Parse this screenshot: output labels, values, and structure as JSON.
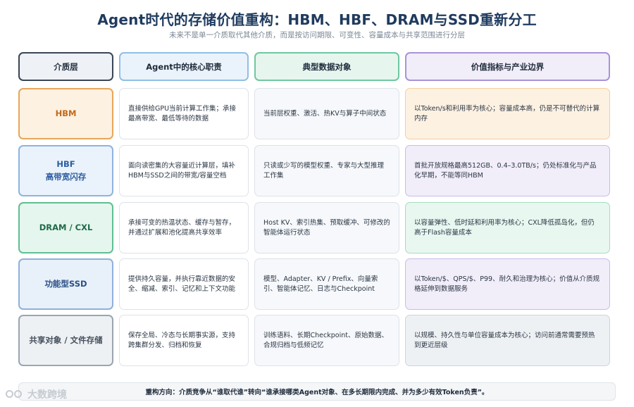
{
  "title": "Agent时代的存储价值重构：HBM、HBF、DRAM与SSD重新分工",
  "subtitle": "未来不是单一介质取代其他介质，而是按访问期限、可变性、容量成本与共享范围进行分层",
  "headers": [
    "介质层",
    "Agent中的核心职责",
    "典型数据对象",
    "价值指标与产业边界"
  ],
  "rows": [
    {
      "label": [
        "HBM"
      ],
      "duty": "直接供给GPU当前计算工作集；承接最高带宽、最低等待的数据",
      "objects": "当前层权重、激活、热KV与算子中间状态",
      "value": "以Token/s和利用率为核心；容量成本高，仍是不可替代的计算内存"
    },
    {
      "label": [
        "HBF",
        "高带宽闪存"
      ],
      "duty": "面向读密集的大容量近计算层，填补HBM与SSD之间的带宽/容量空档",
      "objects": "只读或少写的模型权重、专家与大型推理工作集",
      "value": "首批开放规格最高512GB、0.4–3.0TB/s；仍处标准化与产品化早期，不能等同HBM"
    },
    {
      "label": [
        "DRAM / CXL"
      ],
      "duty": "承接可变的热温状态、缓存与暂存，并通过扩展和池化提高共享效率",
      "objects": "Host KV、索引热集、预取缓冲、可修改的智能体运行状态",
      "value": "以容量弹性、低时延和利用率为核心；CXL降低孤岛化，但仍高于Flash容量成本"
    },
    {
      "label": [
        "功能型SSD"
      ],
      "duty": "提供持久容量，并执行靠近数据的安全、缩减、索引、记忆和上下文功能",
      "objects": "模型、Adapter、KV / Prefix、向量索引、智能体记忆、日志与Checkpoint",
      "value": "以Token/$、QPS/$、P99、耐久和治理为核心；价值从介质规格延伸到数据服务"
    },
    {
      "label": [
        "共享对象 / 文件存储"
      ],
      "duty": "保存全局、冷态与长期事实源，支持跨集群分发、归档和恢复",
      "objects": "训练语料、长期Checkpoint、原始数据、合规归档与低频记忆",
      "value": "以规模、持久性与单位容量成本为核心；访问前通常需要预热到更近层级"
    }
  ],
  "footer": "重构方向：介质竞争从“谁取代谁”转向“谁承接哪类Agent对象、在多长期限内完成、并为多少有效Token负责”。",
  "watermark": "大数跨境"
}
